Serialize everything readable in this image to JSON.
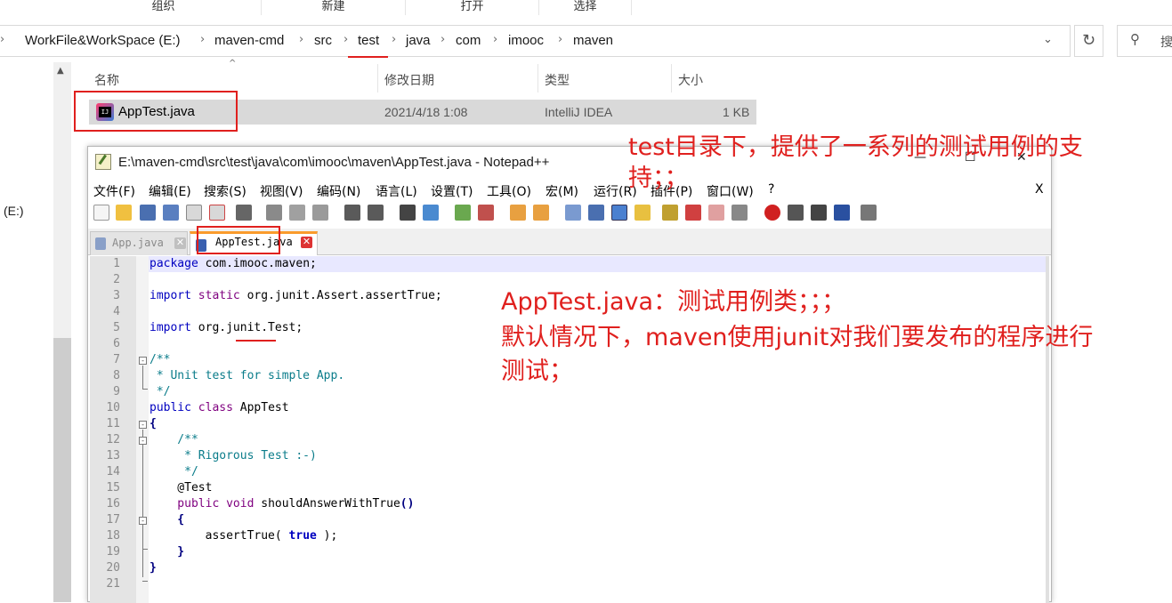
{
  "ribbon": {
    "groups": [
      "组织",
      "新建",
      "打开",
      "选择"
    ]
  },
  "address_bar": {
    "crumbs": [
      "WorkFile&WorkSpace (E:)",
      "maven-cmd",
      "src",
      "test",
      "java",
      "com",
      "imooc",
      "maven"
    ],
    "dropdown_icon": "chevron-down-icon",
    "refresh_icon": "refresh-icon",
    "search_icon": "search-icon",
    "search_placeholder": "搜"
  },
  "nav": {
    "drive_label": "(E:)"
  },
  "file_list": {
    "columns": [
      "名称",
      "修改日期",
      "类型",
      "大小"
    ],
    "rows": [
      {
        "name": "AppTest.java",
        "modified": "2021/4/18 1:08",
        "type": "IntelliJ IDEA",
        "size": "1 KB",
        "icon": "intellij-file-icon"
      }
    ]
  },
  "notepad": {
    "title": "E:\\maven-cmd\\src\\test\\java\\com\\imooc\\maven\\AppTest.java - Notepad++",
    "window_controls": {
      "minimize": "—",
      "maximize": "☐",
      "close": "✕"
    },
    "menus": [
      "文件(F)",
      "编辑(E)",
      "搜索(S)",
      "视图(V)",
      "编码(N)",
      "语言(L)",
      "设置(T)",
      "工具(O)",
      "宏(M)",
      "运行(R)",
      "插件(P)",
      "窗口(W)",
      "?"
    ],
    "menu_close": "X",
    "tabs": [
      {
        "label": "App.java",
        "active": false
      },
      {
        "label": "AppTest.java",
        "active": true
      }
    ],
    "tab_close_glyph": "✕",
    "line_numbers": [
      "1",
      "2",
      "3",
      "4",
      "5",
      "6",
      "7",
      "8",
      "9",
      "10",
      "11",
      "12",
      "13",
      "14",
      "15",
      "16",
      "17",
      "18",
      "19",
      "20",
      "21"
    ],
    "code": {
      "l1_kw": "package",
      "l1_rest": " com.imooc.maven;",
      "l3_kw": "import",
      "l3_kw2": " static",
      "l3_rest": " org.junit.Assert.assertTrue;",
      "l5_kw": "import",
      "l5_rest": " org.junit.Test;",
      "l7": "/**",
      "l8": " * Unit test for simple App.",
      "l9": " */",
      "l10_kw": "public",
      "l10_kw2": " class",
      "l10_rest": " AppTest",
      "l11": "{",
      "l12": "    /**",
      "l13": "     * Rigorous Test :-)",
      "l14": "     */",
      "l15": "    @Test",
      "l16_kw": "    public",
      "l16_kw2": " void",
      "l16_rest": " shouldAnswerWithTrue",
      "l16_paren": "()",
      "l17": "    {",
      "l18_pre": "        assertTrue(",
      "l18_kw": " true",
      "l18_post": " );",
      "l19": "    }",
      "l20": "}",
      "l21": ""
    }
  },
  "annotations": {
    "a1": "test目录下，提供了一系列的测试用例的支",
    "a1b": "持；；",
    "a2": "AppTest.java：测试用例类；；；",
    "a3": "默认情况下，maven使用junit对我们要发布的程序进行",
    "a4": "测试；"
  },
  "colors": {
    "annotation_red": "#e0201e",
    "keyword_blue": "#0000c0",
    "comment_teal": "#0a7c8a",
    "tab_accent": "#fa9b2c"
  }
}
